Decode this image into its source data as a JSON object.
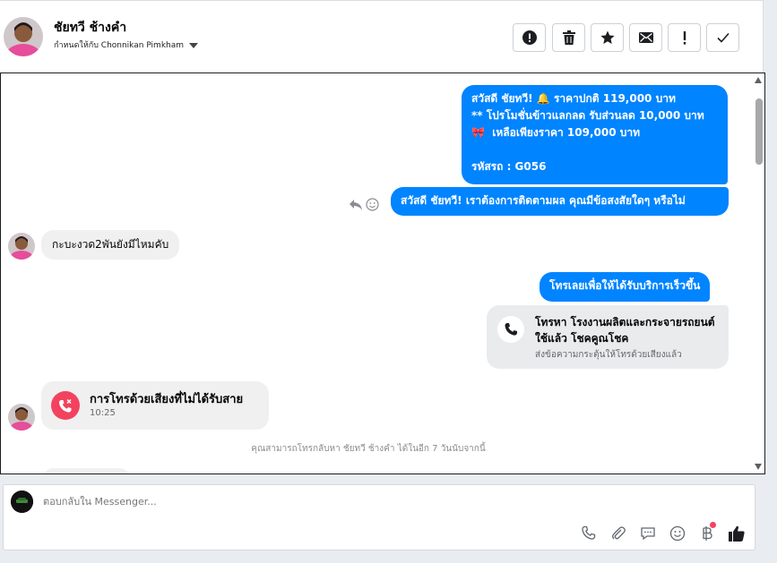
{
  "header": {
    "contact_name": "ชัยทวี ช้างคำ",
    "assigned_label": "กำหนดให้กับ Chonnikan Pimkham",
    "actions": [
      {
        "name": "report-button",
        "icon": "exclamation-circle-icon"
      },
      {
        "name": "delete-button",
        "icon": "trash-icon"
      },
      {
        "name": "star-button",
        "icon": "star-icon"
      },
      {
        "name": "mark-unread-button",
        "icon": "envelope-icon"
      },
      {
        "name": "follow-up-button",
        "icon": "exclamation-icon"
      },
      {
        "name": "done-button",
        "icon": "check-icon"
      }
    ]
  },
  "thread": {
    "messages": [
      {
        "id": "msg-1",
        "direction": "outgoing",
        "text": "สวัสดี ชัยทวี! 🔔 ราคาปกติ 119,000 บาท\n** โปรโมชั่นข้าวแลกลด รับส่วนลด 10,000 บาท\n🎀  เหลือเพียงราคา 109,000 บาท\n\nรหัสรถ : G056"
      },
      {
        "id": "msg-2",
        "direction": "outgoing",
        "text": "สวัสดี ชัยทวี! เราต้องการติดตามผล คุณมีข้อสงสัยใดๆ หรือไม่"
      },
      {
        "id": "msg-3",
        "direction": "incoming",
        "text": "กะบะงวด2พันยังมีไหมคับ"
      },
      {
        "id": "msg-4",
        "direction": "outgoing",
        "text": "โทรเลยเพื่อให้ได้รับบริการเร็วขึ้น"
      }
    ],
    "call_card": {
      "title": "โทรหา โรงงานผลิตและกระจายรถยนต์ใช้แล้ว โชคคูณโชค",
      "subtitle": "ส่งข้อความกระตุ้นให้โทรด้วยเสียงแล้ว"
    },
    "missed_call": {
      "title": "การโทรด้วยเสียงที่ไม่ได้รับสาย",
      "time": "10:25"
    },
    "callback_note": "คุณสามารถโทรกลับหา ชัยทวี ช้างคำ ได้ในอีก 7 วันนับจากนี้"
  },
  "composer": {
    "placeholder": "ตอบกลับใน Messenger...",
    "tools": [
      "phone-icon",
      "paperclip-icon",
      "speech-bubble-icon",
      "emoji-icon",
      "baht-icon",
      "thumbs-up-icon"
    ]
  },
  "colors": {
    "outgoing_bubble": "#0084ff",
    "incoming_bubble": "#f0f0f0",
    "missed_call": "#f3425f",
    "notification_dot": "#f3425f"
  }
}
